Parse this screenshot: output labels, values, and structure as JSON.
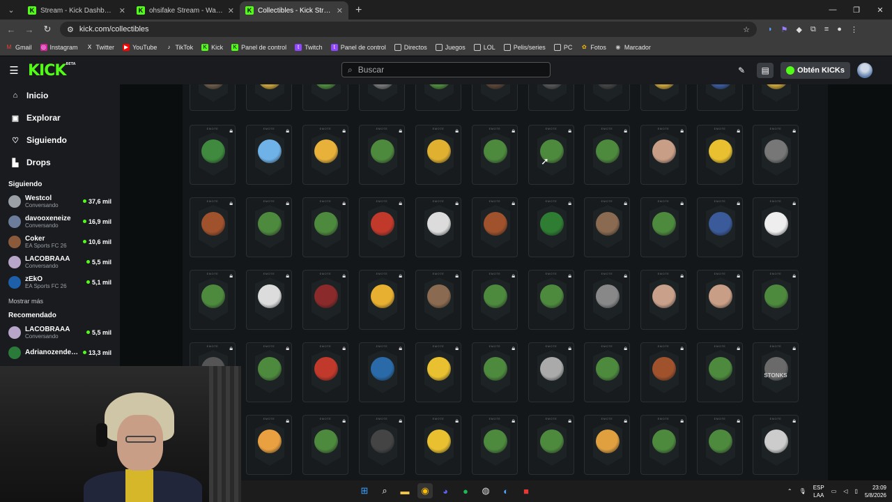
{
  "browser": {
    "tabs": [
      {
        "title": "Stream - Kick Dashboard",
        "active": false
      },
      {
        "title": "ohsifake Stream - Watch Live on Kick",
        "active": false
      },
      {
        "title": "Collectibles - Kick Streaming",
        "active": true
      }
    ],
    "url": "kick.com/collectibles",
    "bookmarks": [
      "Gmail",
      "Instagram",
      "Twitter",
      "YouTube",
      "TikTok",
      "Kick",
      "Panel de control",
      "Twitch",
      "Panel de control",
      "Directos",
      "Juegos",
      "LOL",
      "Pelis/series",
      "PC",
      "Fotos",
      "Marcador"
    ]
  },
  "header": {
    "logo": "KICK",
    "logo_badge": "BETA",
    "search_placeholder": "Buscar",
    "kicks_button": "Obtén KICKs"
  },
  "sidebar": {
    "nav": [
      {
        "label": "Inicio",
        "icon": "home-icon"
      },
      {
        "label": "Explorar",
        "icon": "compass-icon"
      },
      {
        "label": "Siguiendo",
        "icon": "heart-icon"
      },
      {
        "label": "Drops",
        "icon": "drops-icon"
      }
    ],
    "following_title": "Siguiendo",
    "following": [
      {
        "name": "Westcol",
        "game": "Conversando",
        "viewers": "37,6 mil",
        "color": "#9aa0a6"
      },
      {
        "name": "davooxeneize",
        "game": "Conversando",
        "viewers": "16,9 mil",
        "color": "#6b7d9a"
      },
      {
        "name": "Coker",
        "game": "EA Sports FC 26",
        "viewers": "10,6 mil",
        "color": "#8a5a3a"
      },
      {
        "name": "LACOBRAAA",
        "game": "Conversando",
        "viewers": "5,5 mil",
        "color": "#b7a6c9"
      },
      {
        "name": "zEkO",
        "game": "EA Sports FC 26",
        "viewers": "5,1 mil",
        "color": "#1d5fa8"
      }
    ],
    "show_more": "Mostrar más",
    "recommended_title": "Recomendado",
    "recommended": [
      {
        "name": "LACOBRAAA",
        "game": "Conversando",
        "viewers": "5,5 mil",
        "color": "#b7a6c9"
      },
      {
        "name": "Adrianozendej...",
        "game": "",
        "viewers": "13,3 mil",
        "color": "#2a7a3a"
      }
    ]
  },
  "collectibles": {
    "card_tag": "EMOTE",
    "rows": [
      {
        "partial": true,
        "colors": [
          "#6b5a48",
          "#c8a23a",
          "#4e8a3e",
          "#777",
          "#4e8a3e",
          "#5a4538",
          "#555",
          "#444",
          "#c8a23a",
          "#3a5a9a",
          "#c8a23a"
        ]
      },
      {
        "partial": false,
        "colors": [
          "#3f8a3e",
          "#6fb2e8",
          "#e8b23a",
          "#4e8a3e",
          "#e0b030",
          "#4e8a3e",
          "#4e8a3e",
          "#4e8a3e",
          "#c99e86",
          "#e8c030",
          "#777"
        ]
      },
      {
        "partial": false,
        "colors": [
          "#a0522d",
          "#4e8a3e",
          "#4e8a3e",
          "#c0392b",
          "#dcdcdc",
          "#a0522d",
          "#2e7d32",
          "#8a6a50",
          "#4e8a3e",
          "#3a5a9a",
          "#eeeeee"
        ]
      },
      {
        "partial": false,
        "colors": [
          "#4e8a3e",
          "#dcdcdc",
          "#8b2a2a",
          "#e8b030",
          "#8a6a50",
          "#4e8a3e",
          "#4e8a3e",
          "#888",
          "#c9a08a",
          "#c99e86",
          "#4e8a3e"
        ]
      },
      {
        "partial": false,
        "colors": [
          "#555",
          "#4e8a3e",
          "#c0392b",
          "#2a6aa8",
          "#e8c030",
          "#4e8a3e",
          "#aaaaaa",
          "#4e8a3e",
          "#a0522d",
          "#4e8a3e",
          "#6a6a6a"
        ]
      },
      {
        "partial": false,
        "colors": [
          null,
          "#e8a040",
          "#4e8a3e",
          "#444",
          "#e8c030",
          "#4e8a3e",
          "#4e8a3e",
          "#e0a040",
          "#4e8a3e",
          "#4e8a3e",
          "#cccccc"
        ]
      }
    ],
    "stonks_label": "STONKS"
  },
  "taskbar": {
    "lang_top": "ESP",
    "lang_bottom": "LAA",
    "time": "23:09",
    "date": "5/8/2026"
  }
}
